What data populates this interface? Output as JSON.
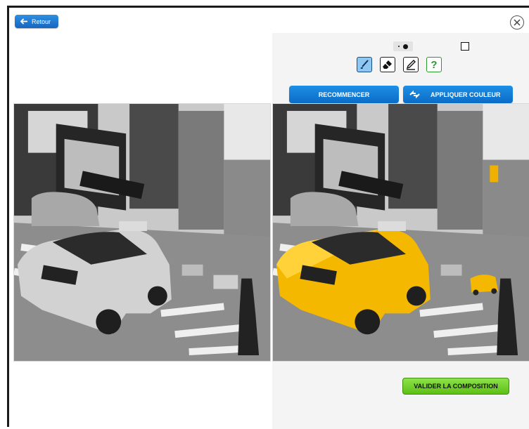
{
  "header": {
    "back_label": "Retour"
  },
  "toolbar": {
    "brush_sizes": [
      "small-dot-icon",
      "large-dot-icon"
    ],
    "shape": "square-icon",
    "tools": [
      {
        "name": "brush-tool",
        "icon": "brush-icon",
        "active": true
      },
      {
        "name": "eraser-tool",
        "icon": "eraser-icon",
        "active": false
      },
      {
        "name": "pen-tool",
        "icon": "pen-icon",
        "active": false
      },
      {
        "name": "help-tool",
        "icon": "help-icon",
        "label": "?",
        "active": false
      }
    ],
    "restart_label": "RECOMMENCER",
    "apply_color_label": "APPLIQUER COULEUR"
  },
  "footer": {
    "validate_label": "VALIDER LA COMPOSITION"
  },
  "images": {
    "original": "grayscale-city-taxi-photo",
    "colorized": "city-taxi-yellow-splash-photo"
  },
  "colors": {
    "accent_blue": "#1566c2",
    "validate_green": "#6ecf1f",
    "taxi_yellow": "#f5b800",
    "active_tool": "#8ec8f2"
  }
}
